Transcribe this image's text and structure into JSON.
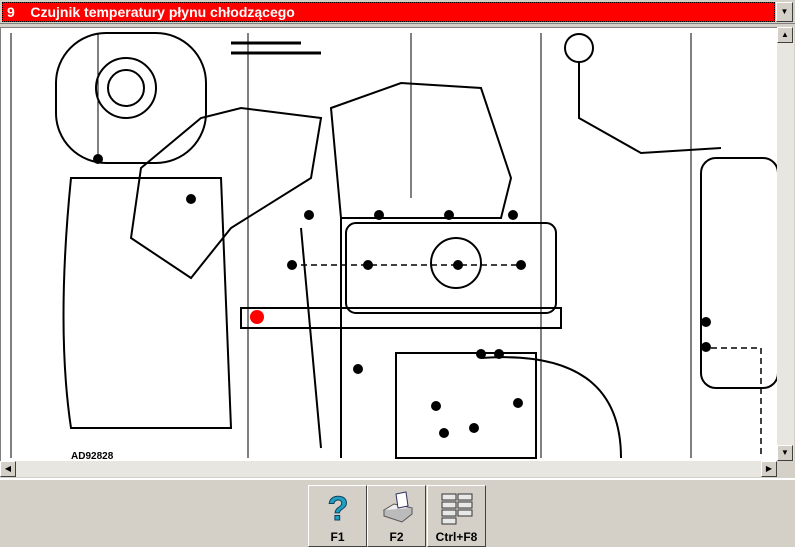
{
  "title": {
    "number": "9",
    "text": "Czujnik temperatury płynu chłodzącego"
  },
  "diagram": {
    "code": "AD92828",
    "highlight_color": "#ff0000"
  },
  "buttons": [
    {
      "label": "F1",
      "icon": "help-icon"
    },
    {
      "label": "F2",
      "icon": "printer-icon"
    },
    {
      "label": "Ctrl+F8",
      "icon": "grid-icon"
    }
  ]
}
